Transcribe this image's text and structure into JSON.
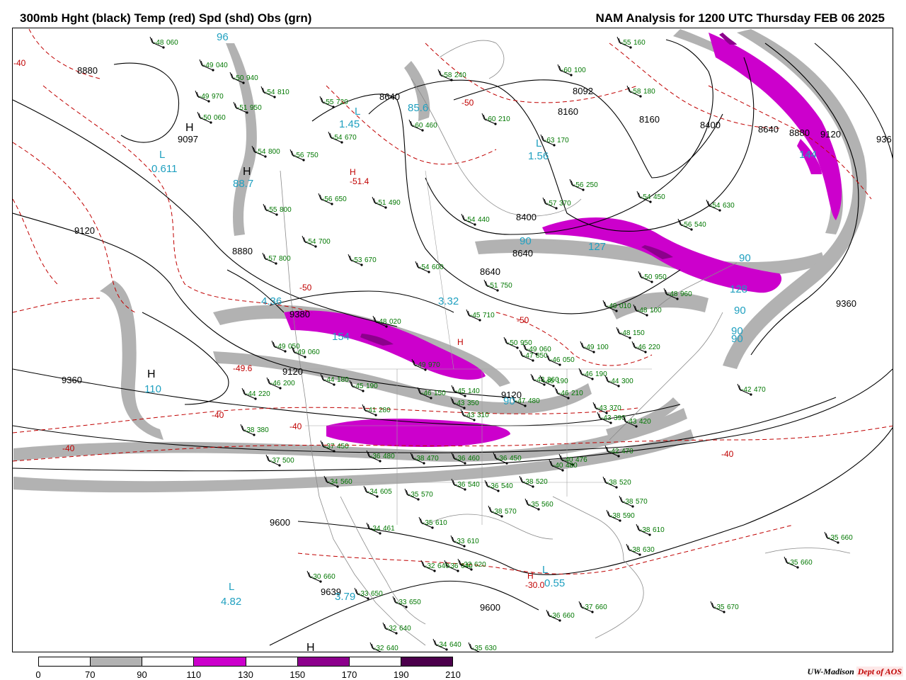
{
  "header": {
    "left_title": "300mb Hght (black) Temp (red) Spd (shd) Obs (grn)",
    "right_title": "NAM Analysis for 1200 UTC Thursday  FEB 06 2025"
  },
  "colors": {
    "height_contour": "#000000",
    "temperature_contour": "#c00000",
    "observation": "#007700",
    "speed_label": "#20a0c0",
    "speed_70_90": "#b2b2b2",
    "speed_110_130": "#cc00cc",
    "speed_150_170": "#8c008c",
    "speed_190_210": "#4c004c"
  },
  "legend": {
    "ticks": [
      "0",
      "70",
      "90",
      "110",
      "130",
      "150",
      "170",
      "190",
      "210"
    ],
    "fills": [
      "#ffffff",
      "#b2b2b2",
      "#ffffff",
      "#cc00cc",
      "#ffffff",
      "#8c008c",
      "#ffffff",
      "#4c004c"
    ]
  },
  "credit": {
    "org": "UW-Madison",
    "dept": "Dept of AOS"
  },
  "height_labels": [
    "8880",
    "9097",
    "9120",
    "8880",
    "8640",
    "8092",
    "8160",
    "8160",
    "8400",
    "8640",
    "8880",
    "9120",
    "936",
    "8400",
    "8640",
    "8640",
    "9360",
    "9360",
    "9120",
    "9380",
    "9120",
    "9600",
    "9600",
    "9639"
  ],
  "temp_labels": [
    "-40",
    "-50",
    "-51.4",
    "-50",
    "-50",
    "-49.6",
    "-40",
    "-40",
    "-40",
    "-40",
    "-30.0"
  ],
  "center_letters": [
    "H",
    "H",
    "H",
    "H",
    "H",
    "H",
    "H"
  ],
  "speed_labels": [
    "96",
    "L",
    "0.611",
    "88.7",
    "L",
    "1.45",
    "85.6",
    "L",
    "1.56",
    "4.36",
    "3.32",
    "154",
    "127",
    "128",
    "90",
    "90",
    "90",
    "90",
    "90",
    "90",
    "110",
    "L",
    "4.82",
    "3.79",
    "L",
    "0.55",
    "144"
  ],
  "observations": [
    {
      "t": "-48",
      "h": "060"
    },
    {
      "t": "-49",
      "h": "040"
    },
    {
      "t": "-50",
      "h": "940"
    },
    {
      "t": "-49",
      "h": "970"
    },
    {
      "t": "-50",
      "h": "060"
    },
    {
      "t": "-51",
      "h": "950"
    },
    {
      "t": "-54",
      "h": "810"
    },
    {
      "t": "-55",
      "h": "720"
    },
    {
      "t": "-54",
      "h": "670"
    },
    {
      "t": "-54",
      "h": "800"
    },
    {
      "t": "-56",
      "h": "750"
    },
    {
      "t": "-55",
      "h": "800"
    },
    {
      "t": "-56",
      "h": "650"
    },
    {
      "t": "-51",
      "h": "490"
    },
    {
      "t": "-54",
      "h": "700"
    },
    {
      "t": "-53",
      "h": "670"
    },
    {
      "t": "-57",
      "h": "800"
    },
    {
      "t": "-54",
      "h": "600"
    },
    {
      "t": "-51",
      "h": "750"
    },
    {
      "t": "-55",
      "h": "160"
    },
    {
      "t": "-60",
      "h": "100"
    },
    {
      "t": "-58",
      "h": "180"
    },
    {
      "t": "-58",
      "h": "240"
    },
    {
      "t": "-60",
      "h": "460"
    },
    {
      "t": "-60",
      "h": "210"
    },
    {
      "t": "-63",
      "h": "170"
    },
    {
      "t": "-56",
      "h": "250"
    },
    {
      "t": "-54",
      "h": "450"
    },
    {
      "t": "-54",
      "h": "630"
    },
    {
      "t": "-57",
      "h": "370"
    },
    {
      "t": "-54",
      "h": "440"
    },
    {
      "t": "-56",
      "h": "540"
    },
    {
      "t": "-50",
      "h": "950"
    },
    {
      "t": "-48",
      "h": "960"
    },
    {
      "t": "-49",
      "h": "010"
    },
    {
      "t": "-48",
      "h": "100"
    },
    {
      "t": "-48",
      "h": "150"
    },
    {
      "t": "-46",
      "h": "220"
    },
    {
      "t": "-45",
      "h": "710"
    },
    {
      "t": "-47",
      "h": "850"
    },
    {
      "t": "-49",
      "h": "100"
    },
    {
      "t": "-46",
      "h": "050"
    },
    {
      "t": "-46",
      "h": "190"
    },
    {
      "t": "-44",
      "h": "300"
    },
    {
      "t": "-46",
      "h": "210"
    },
    {
      "t": "-43",
      "h": "370"
    },
    {
      "t": "-43",
      "h": "390"
    },
    {
      "t": "-43",
      "h": "420"
    },
    {
      "t": "-42",
      "h": "470"
    },
    {
      "t": "-42",
      "h": "470"
    },
    {
      "t": "-40",
      "h": "476"
    },
    {
      "t": "-40",
      "h": "480"
    },
    {
      "t": "-38",
      "h": "520"
    },
    {
      "t": "-38",
      "h": "570"
    },
    {
      "t": "-38",
      "h": "590"
    },
    {
      "t": "-38",
      "h": "610"
    },
    {
      "t": "-38",
      "h": "630"
    },
    {
      "t": "-35",
      "h": "660"
    },
    {
      "t": "-35",
      "h": "660"
    },
    {
      "t": "-35",
      "h": "670"
    },
    {
      "t": "-37",
      "h": "660"
    },
    {
      "t": "-36",
      "h": "660"
    },
    {
      "t": "-49",
      "h": "050"
    },
    {
      "t": "-49",
      "h": "060"
    },
    {
      "t": "-46",
      "h": "200"
    },
    {
      "t": "-44",
      "h": "220"
    },
    {
      "t": "-38",
      "h": "380"
    },
    {
      "t": "-37",
      "h": "450"
    },
    {
      "t": "-36",
      "h": "480"
    },
    {
      "t": "-38",
      "h": "470"
    },
    {
      "t": "-36",
      "h": "460"
    },
    {
      "t": "-36",
      "h": "450"
    },
    {
      "t": "-37",
      "h": "500"
    },
    {
      "t": "-34",
      "h": "560"
    },
    {
      "t": "-34",
      "h": "605"
    },
    {
      "t": "-35",
      "h": "570"
    },
    {
      "t": "-36",
      "h": "540"
    },
    {
      "t": "-36",
      "h": "540"
    },
    {
      "t": "-38",
      "h": "520"
    },
    {
      "t": "-38",
      "h": "570"
    },
    {
      "t": "-35",
      "h": "560"
    },
    {
      "t": "-34",
      "h": "461"
    },
    {
      "t": "-35",
      "h": "610"
    },
    {
      "t": "-33",
      "h": "610"
    },
    {
      "t": "-36",
      "h": "640"
    },
    {
      "t": "-32",
      "h": "640"
    },
    {
      "t": "-32",
      "h": "620"
    },
    {
      "t": "-30",
      "h": "660"
    },
    {
      "t": "-33",
      "h": "650"
    },
    {
      "t": "-33",
      "h": "650"
    },
    {
      "t": "-32",
      "h": "640"
    },
    {
      "t": "-32",
      "h": "640"
    },
    {
      "t": "-34",
      "h": "640"
    },
    {
      "t": "-35",
      "h": "630"
    },
    {
      "t": "-41",
      "h": "280"
    },
    {
      "t": "-44",
      "h": "180"
    },
    {
      "t": "-45",
      "h": "190"
    },
    {
      "t": "-46",
      "h": "150"
    },
    {
      "t": "-45",
      "h": "140"
    },
    {
      "t": "-43",
      "h": "310"
    },
    {
      "t": "-46",
      "h": "190"
    },
    {
      "t": "-49",
      "h": "060"
    },
    {
      "t": "-49",
      "h": "970"
    },
    {
      "t": "-48",
      "h": "020"
    },
    {
      "t": "-50",
      "h": "950"
    },
    {
      "t": "-43",
      "h": "360"
    },
    {
      "t": "-43",
      "h": "350"
    },
    {
      "t": "-47",
      "h": "480"
    }
  ]
}
